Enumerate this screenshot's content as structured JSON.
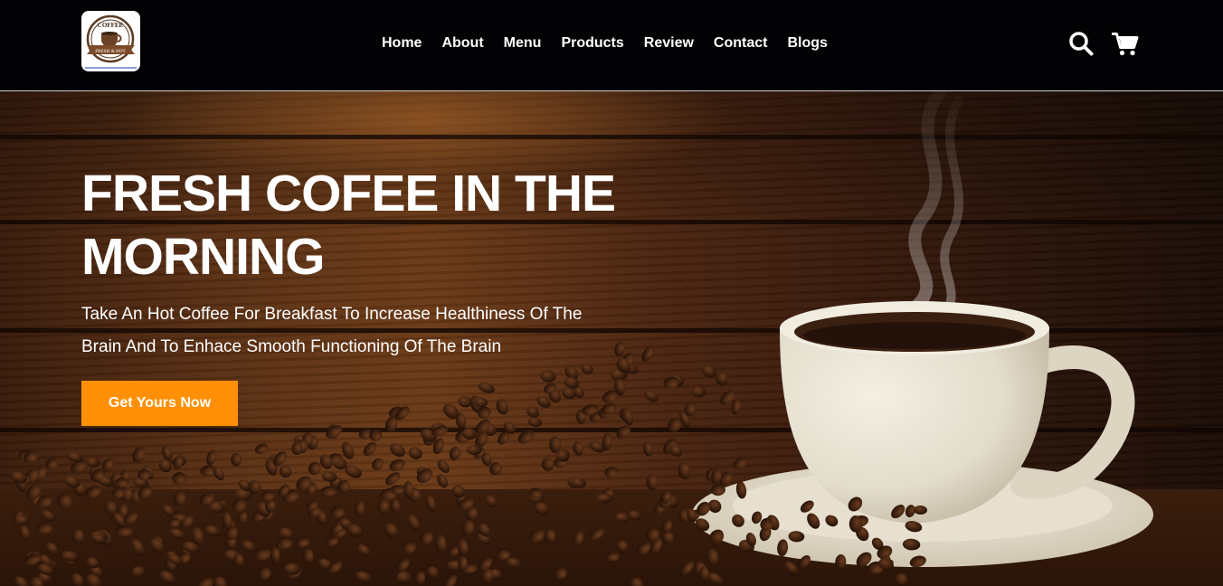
{
  "header": {
    "logo_icon": "coffee-cup-badge-icon",
    "logo_text": "COFFEE",
    "logo_banner_text": "FRESH & HOT",
    "nav": [
      {
        "label": "Home"
      },
      {
        "label": "About"
      },
      {
        "label": "Menu"
      },
      {
        "label": "Products"
      },
      {
        "label": "Review"
      },
      {
        "label": "Contact"
      },
      {
        "label": "Blogs"
      }
    ],
    "search_icon": "search-icon",
    "cart_icon": "cart-icon"
  },
  "hero": {
    "title": "FRESH COFEE IN THE MORNING",
    "subtitle": "Take An Hot Coffee For Breakfast To Increase Healthiness Of The Brain And To Enhace Smooth Functioning Of The Brain",
    "cta_label": "Get Yours Now",
    "image": "coffee-cup-with-beans-photo"
  },
  "colors": {
    "header_bg": "#020204",
    "accent": "#ff9006",
    "text": "#ffffff",
    "wood": "#5a3014"
  }
}
